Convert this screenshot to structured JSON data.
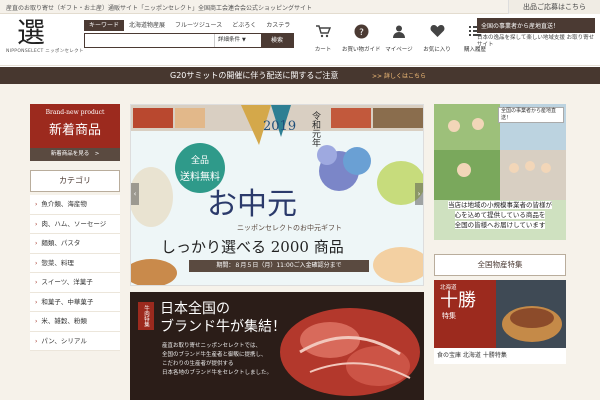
{
  "topbar": {
    "tagline": "産直のお取り寄せ（ギフト・お土産）通販サイト「ニッポンセレクト」全国商工会連合会公式ショッピングサイト",
    "apply_label": "出品ご応募はこちら"
  },
  "logo": {
    "kanji": "選",
    "latin": "NIPPONSELECT ニッポンセレクト"
  },
  "search": {
    "tabs": [
      "キーワード",
      "北海道物産展",
      "フルーツジュース",
      "どぶろく",
      "カステラ"
    ],
    "placeholder": "",
    "detail_label": "詳細条件",
    "submit_label": "検索"
  },
  "header_icons": [
    {
      "icon": "cart-icon",
      "label": "カート"
    },
    {
      "icon": "help-icon",
      "label": "お買い物ガイド"
    },
    {
      "icon": "user-icon",
      "label": "マイページ"
    },
    {
      "icon": "heart-icon",
      "label": "お気に入り"
    },
    {
      "icon": "history-icon",
      "label": "購入履歴"
    }
  ],
  "header_right": {
    "banner": "全国の事業者から産地直送！",
    "note": "日本の逸品を探して楽しい地域支援 お取り寄せサイト"
  },
  "notice": {
    "message": "G20サミットの開催に伴う配送に関するご注意",
    "more": ">> 詳しくはこちら"
  },
  "left": {
    "new_en": "Brand-new product",
    "new_jp": "新着商品",
    "new_link": "新着商品を見る　>",
    "category_title": "カテゴリ",
    "categories": [
      "魚介類、海産物",
      "肉、ハム、ソーセージ",
      "麺類、パスタ",
      "惣菜、料理",
      "スイーツ、洋菓子",
      "和菓子、中華菓子",
      "米、雑穀、粉類",
      "パン、シリアル"
    ]
  },
  "hero": {
    "year": "2019",
    "era": "令和元年",
    "badge_l1": "全品",
    "badge_l2": "送料無料",
    "title": "お中元",
    "subtitle": "ニッポンセレクトのお中元ギフト",
    "copy": "しっかり選べる 2000 商品",
    "period": "期間：８月５日（月）11:00ご入金確認分まで"
  },
  "beef": {
    "tag": "牛肉特集",
    "title1": "日本全国の",
    "title2": "ブランド牛が集結！",
    "body": [
      "産直お取り寄せニッポンセレクトでは、",
      "全国のブランド牛生産者と御販に提携し、",
      "こだわりの生産者が提供する",
      "日本各地のブランド牛をセレクトしました。"
    ]
  },
  "right": {
    "banner": "全国の事業者から産地直送！",
    "caption_lines": [
      "当店は地域の小規模事業者の皆様が",
      "心を込めて提供している商品を",
      "全国の皆様へお届けしています"
    ],
    "feature_title": "全国物産特集",
    "tokachi_pref": "北海道",
    "tokachi_big": "十勝",
    "tokachi_fea": "特集",
    "tokachi_caption": "食の宝庫 北海道 十勝特集"
  }
}
